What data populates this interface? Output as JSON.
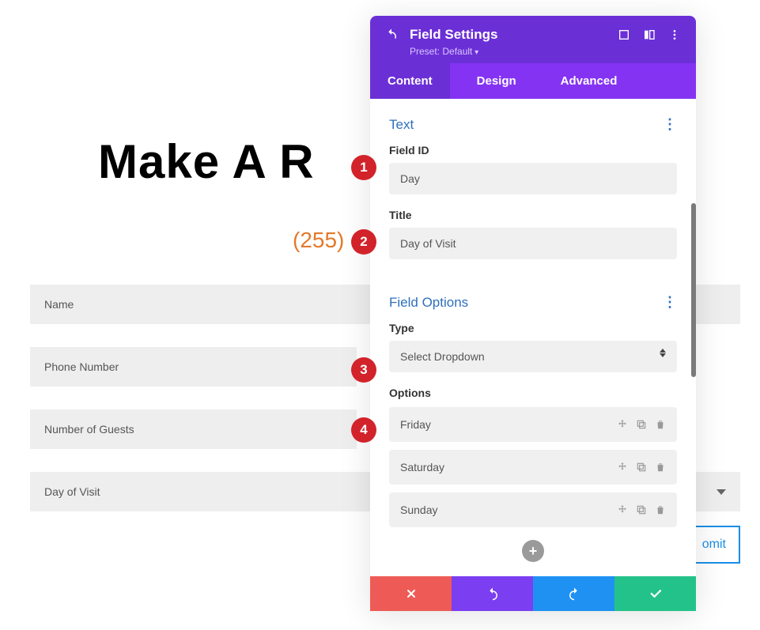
{
  "background": {
    "title": "Make A R",
    "phone_prefix": "(255)",
    "fields": {
      "name": "Name",
      "phone": "Phone Number",
      "guests": "Number of Guests",
      "day": "Day of Visit"
    },
    "submit_fragment": "omit"
  },
  "panel": {
    "title": "Field Settings",
    "preset": "Preset: Default",
    "tabs": {
      "content": "Content",
      "design": "Design",
      "advanced": "Advanced"
    }
  },
  "sections": {
    "text": {
      "heading": "Text",
      "field_id_label": "Field ID",
      "field_id_value": "Day",
      "title_label": "Title",
      "title_value": "Day of Visit"
    },
    "field_options": {
      "heading": "Field Options",
      "type_label": "Type",
      "type_value": "Select Dropdown",
      "options_label": "Options",
      "options": [
        "Friday",
        "Saturday",
        "Sunday"
      ]
    }
  },
  "markers": {
    "m1": "1",
    "m2": "2",
    "m3": "3",
    "m4": "4"
  }
}
